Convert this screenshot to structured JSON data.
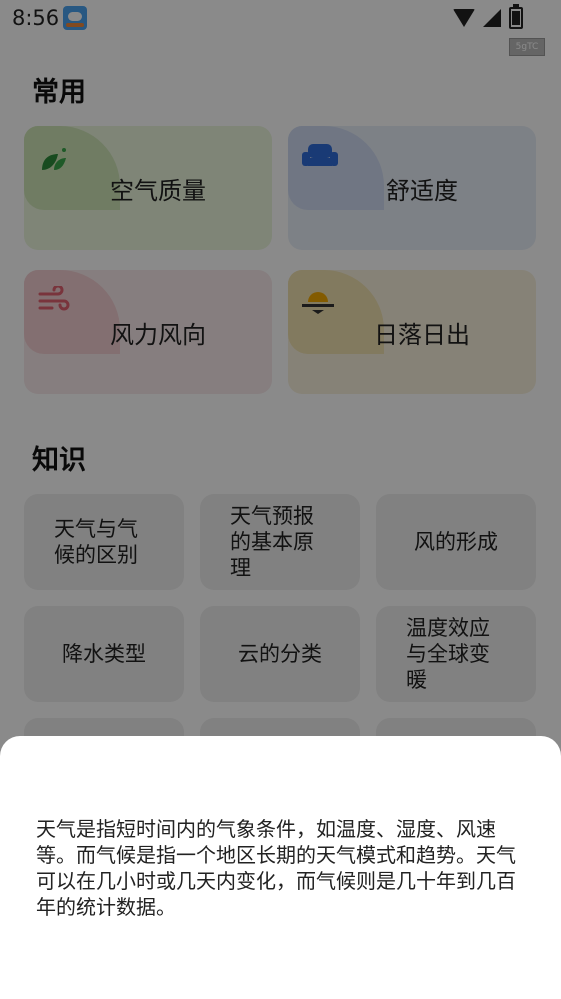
{
  "status_bar": {
    "time": "8:56",
    "right_badge": "5gTC"
  },
  "common": {
    "title": "常用",
    "cards": [
      {
        "label": "空气质量",
        "icon": "leaf-icon",
        "color": "#eaf5dd",
        "blob": "#cfe6b8"
      },
      {
        "label": "舒适度",
        "icon": "sofa-icon",
        "color": "#e8eef8",
        "blob": "#cfdbf2"
      },
      {
        "label": "风力风向",
        "icon": "wind-icon",
        "color": "#f8e9ea",
        "blob": "#f2cdd1"
      },
      {
        "label": "日落日出",
        "icon": "sunset-icon",
        "color": "#f8f1dd",
        "blob": "#f1e1b0"
      }
    ]
  },
  "knowledge": {
    "title": "知识",
    "items": [
      "天气与气候的区别",
      "天气预报的基本原理",
      "风的形成",
      "降水类型",
      "云的分类",
      "温度效应与全球变暖"
    ]
  },
  "sheet": {
    "text": "天气是指短时间内的气象条件，如温度、湿度、风速等。而气候是指一个地区长期的天气模式和趋势。天气可以在几小时或几天内变化，而气候则是几十年到几百年的统计数据。"
  }
}
